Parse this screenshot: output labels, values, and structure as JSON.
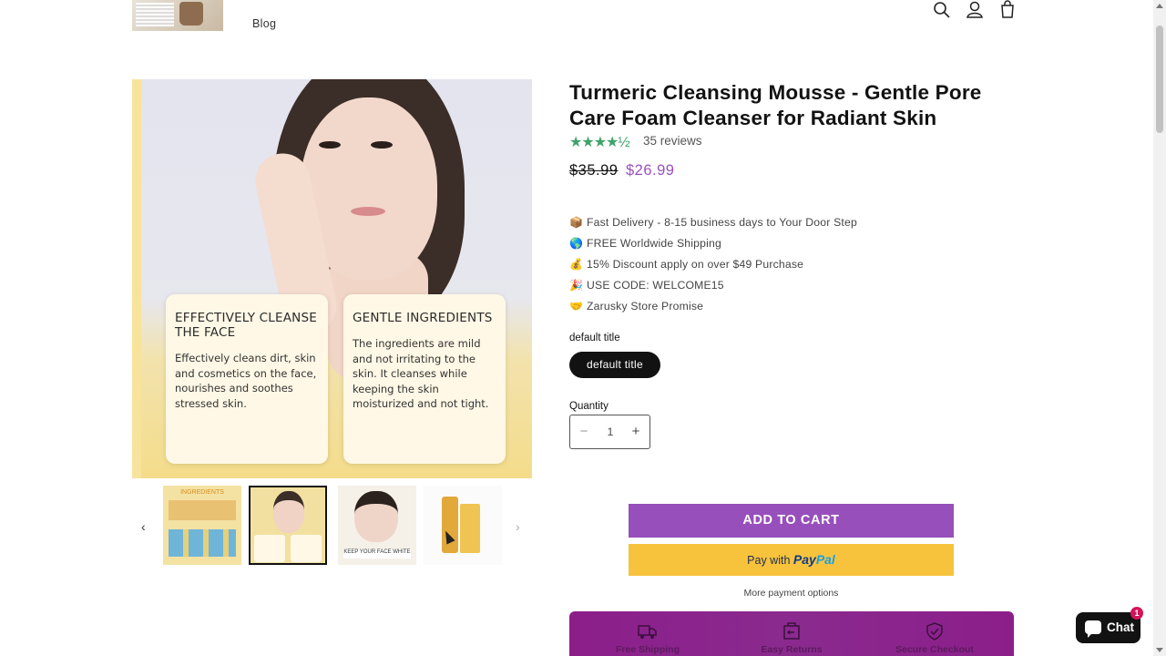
{
  "header": {
    "nav_blog": "Blog",
    "icons": [
      "search-icon",
      "account-icon",
      "cart-icon"
    ]
  },
  "gallery": {
    "cards": [
      {
        "heading": "EFFECTIVELY CLEANSE THE FACE",
        "body": "Effectively cleans dirt, skin and cosmetics on the face, nourishes and soothes stressed skin."
      },
      {
        "heading": "GENTLE INGREDIENTS",
        "body": "The ingredients are mild and not irritating to the skin. It cleanses while keeping the skin moisturized and not tight."
      }
    ],
    "thumb_labels": [
      "INGREDIENTS",
      "",
      "KEEP YOUR FACE WHITE",
      ""
    ],
    "prev_arrow": "‹",
    "next_arrow": "›"
  },
  "product": {
    "title": "Turmeric Cleansing Mousse - Gentle Pore Care Foam Cleanser for Radiant Skin",
    "stars": "★★★★½",
    "rating": 4.5,
    "reviews": "35 reviews",
    "price_old": "$35.99",
    "price_new": "$26.99",
    "perks": [
      {
        "icon": "package-icon",
        "glyph": "📦",
        "text": "Fast Delivery - 8-15 business days to Your Door Step"
      },
      {
        "icon": "globe-icon",
        "glyph": "🌎",
        "text": "FREE Worldwide Shipping"
      },
      {
        "icon": "money-bag-icon",
        "glyph": "💰",
        "text": "15% Discount apply on over $49 Purchase"
      },
      {
        "icon": "party-popper-icon",
        "glyph": "🎉",
        "text": "USE CODE: WELCOME15"
      },
      {
        "icon": "handshake-icon",
        "glyph": "🤝",
        "text": "Zarusky Store Promise"
      }
    ],
    "variant_label": "default title",
    "variant_value": "default title",
    "quantity_label": "Quantity",
    "quantity_value": "1",
    "minus": "−",
    "plus": "+",
    "add_to_cart": "ADD TO CART",
    "paypal_prefix": "Pay with",
    "paypal_brand_a": "Pay",
    "paypal_brand_b": "Pal",
    "more_payment": "More payment options"
  },
  "trust": [
    {
      "icon": "truck-icon",
      "label": "Free Shipping"
    },
    {
      "icon": "returns-icon",
      "label": "Easy Returns"
    },
    {
      "icon": "shield-check-icon",
      "label": "Secure Checkout"
    }
  ],
  "chat": {
    "label": "Chat",
    "badge": "1"
  },
  "colors": {
    "accent_purple": "#974fbb",
    "price_purple": "#9a4fbf",
    "paypal_yellow": "#f7c33d",
    "trust_bar": "#8c1e8a",
    "stars_green": "#3ea36a"
  }
}
